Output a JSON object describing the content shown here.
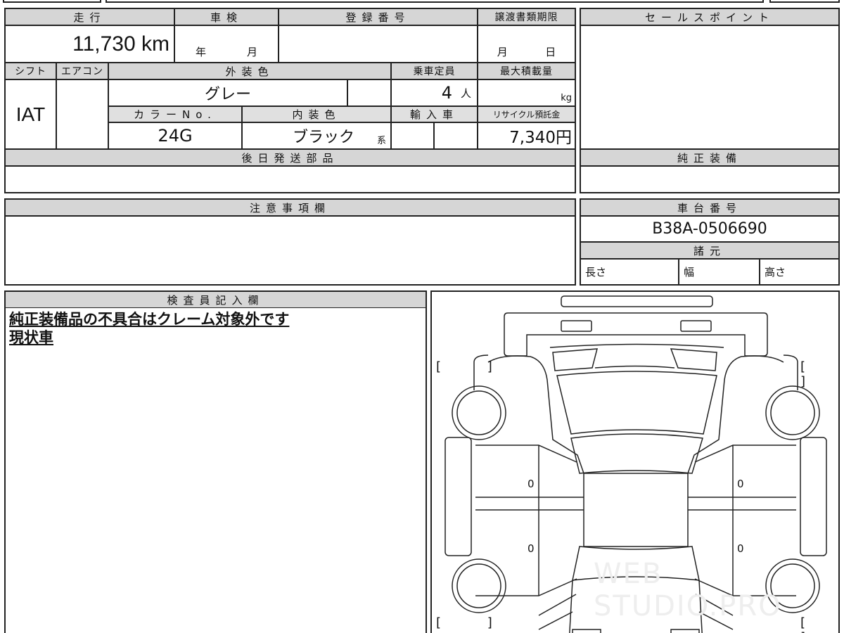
{
  "sheet": {
    "headers": {
      "mileage": "走行",
      "inspection": "車検",
      "registration": "登録番号",
      "transfer_deadline": "譲渡書類期限",
      "sales_point": "セールスポイント",
      "shift": "シフト",
      "aircon": "エアコン",
      "exterior_color": "外装色",
      "capacity": "乗車定員",
      "max_load": "最大積載量",
      "color_no": "カラーNo.",
      "interior_color": "内装色",
      "imported": "輸入車",
      "recycle_fee": "リサイクル預託金",
      "later_parts": "後日発送部品",
      "genuine_equipment": "純正装備",
      "notes": "注意事項欄",
      "chassis_no": "車台番号",
      "specs": "諸元",
      "inspector_notes": "検査員記入欄"
    },
    "values": {
      "mileage": "11,730 km",
      "inspection_year_unit": "年",
      "inspection_month_unit": "月",
      "transfer_month_unit": "月",
      "transfer_day_unit": "日",
      "shift": "IAT",
      "exterior_color": "グレー",
      "capacity": "4",
      "capacity_unit": "人",
      "max_load_unit": "kg",
      "color_no": "24G",
      "interior_color": "ブラック",
      "interior_color_suffix": "系",
      "recycle_fee": "7,340円",
      "chassis_no": "B38A-0506690"
    },
    "specs": {
      "length": "長さ",
      "width": "幅",
      "height": "高さ"
    },
    "inspector_lines": [
      "純正装備品の不具合はクレーム対象外です",
      "現状車"
    ],
    "diagram": {
      "door_marks": [
        "0",
        "0",
        "0",
        "0"
      ],
      "watermark": "WEB STUDIO.PRO"
    }
  }
}
